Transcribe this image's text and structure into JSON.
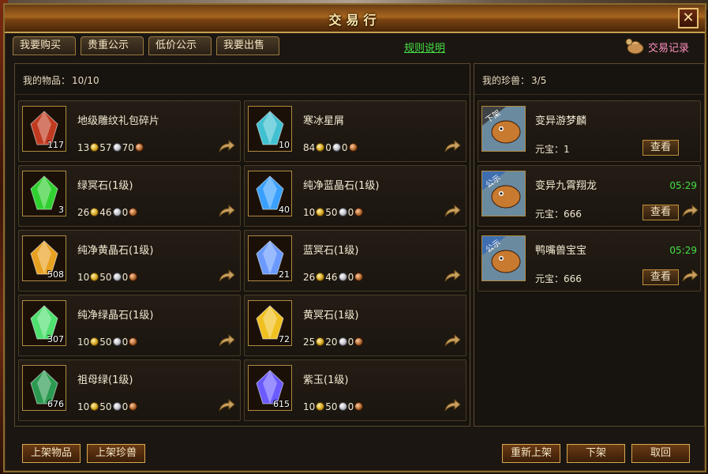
{
  "window": {
    "title": "交易行",
    "close_glyph": "✕"
  },
  "tabs": [
    {
      "label": "我要购买"
    },
    {
      "label": "贵重公示"
    },
    {
      "label": "低价公示"
    },
    {
      "label": "我要出售"
    }
  ],
  "rules_link": "规则说明",
  "records_label": "交易记录",
  "items_panel": {
    "label": "我的物品：",
    "count": "10/10"
  },
  "pets_panel": {
    "label": "我的珍兽：",
    "count": "3/5"
  },
  "items": [
    {
      "name": "地级雕纹礼包碎片",
      "qty": "117",
      "gold": "13",
      "silver": "57",
      "copper": "70",
      "icon": "gift-box-icon",
      "color": "#c03a20"
    },
    {
      "name": "寒冰星屑",
      "qty": "10",
      "gold": "84",
      "silver": "0",
      "copper": "0",
      "icon": "ice-stardust-icon",
      "color": "#40c0d0"
    },
    {
      "name": "绿冥石(1级)",
      "qty": "3",
      "gold": "26",
      "silver": "46",
      "copper": "0",
      "icon": "green-gem-icon",
      "color": "#30d030"
    },
    {
      "name": "纯净蓝晶石(1级)",
      "qty": "40",
      "gold": "10",
      "silver": "50",
      "copper": "0",
      "icon": "blue-crystal-icon",
      "color": "#3aa0ff"
    },
    {
      "name": "纯净黄晶石(1级)",
      "qty": "508",
      "gold": "10",
      "silver": "50",
      "copper": "0",
      "icon": "yellow-crystal-icon",
      "color": "#e8a020"
    },
    {
      "name": "蓝冥石(1级)",
      "qty": "21",
      "gold": "26",
      "silver": "46",
      "copper": "0",
      "icon": "blue-gem-icon",
      "color": "#6a9aff"
    },
    {
      "name": "纯净绿晶石(1级)",
      "qty": "307",
      "gold": "10",
      "silver": "50",
      "copper": "0",
      "icon": "green-crystal-icon",
      "color": "#50e070"
    },
    {
      "name": "黄冥石(1级)",
      "qty": "72",
      "gold": "25",
      "silver": "20",
      "copper": "0",
      "icon": "yellow-gem-icon",
      "color": "#f0c020"
    },
    {
      "name": "祖母绿(1级)",
      "qty": "676",
      "gold": "10",
      "silver": "50",
      "copper": "0",
      "icon": "jade-ring-icon",
      "color": "#2a9a50"
    },
    {
      "name": "紫玉(1级)",
      "qty": "615",
      "gold": "10",
      "silver": "50",
      "copper": "0",
      "icon": "purple-jade-icon",
      "color": "#6a5aff"
    }
  ],
  "pets": [
    {
      "name": "变异游梦麟",
      "value_label": "元宝：",
      "value": "1",
      "badge": "下架",
      "timer": "",
      "view": "查看",
      "icon": "fish-pet-icon"
    },
    {
      "name": "变异九霄翔龙",
      "value_label": "元宝：",
      "value": "666",
      "badge": "公示",
      "timer": "05:29",
      "view": "查看",
      "icon": "dragon-pet-icon"
    },
    {
      "name": "鸭嘴兽宝宝",
      "value_label": "元宝：",
      "value": "666",
      "badge": "公示",
      "timer": "05:29",
      "view": "查看",
      "icon": "platypus-pet-icon"
    }
  ],
  "bottom": {
    "list_item": "上架物品",
    "list_pet": "上架珍兽",
    "relist": "重新上架",
    "delist": "下架",
    "cancel": "取回"
  }
}
